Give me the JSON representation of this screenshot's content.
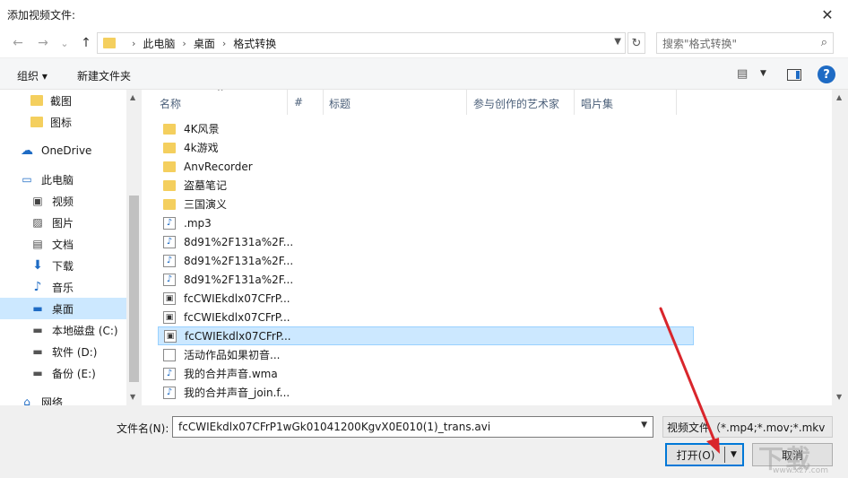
{
  "window": {
    "title": "添加视频文件:",
    "close_glyph": "✕"
  },
  "nav": {
    "back": "←",
    "forward": "→",
    "recent": "⌄",
    "up": "↑",
    "breadcrumbs": [
      "此电脑",
      "桌面",
      "格式转换"
    ],
    "refresh": "↻",
    "search_placeholder": "搜索\"格式转换\""
  },
  "toolbar": {
    "organize": "组织 ▾",
    "new_folder": "新建文件夹",
    "help": "?"
  },
  "sidebar": {
    "items": [
      {
        "label": "截图",
        "icon": "folder-icon"
      },
      {
        "label": "图标",
        "icon": "folder-icon"
      },
      {
        "label": "OneDrive",
        "icon": "cloud-icon"
      },
      {
        "label": "此电脑",
        "icon": "computer-icon"
      },
      {
        "label": "视频",
        "icon": "video-library-icon"
      },
      {
        "label": "图片",
        "icon": "pictures-icon"
      },
      {
        "label": "文档",
        "icon": "documents-icon"
      },
      {
        "label": "下载",
        "icon": "download-icon"
      },
      {
        "label": "音乐",
        "icon": "music-icon"
      },
      {
        "label": "桌面",
        "icon": "desktop-icon",
        "selected": true
      },
      {
        "label": "本地磁盘 (C:)",
        "icon": "disk-icon"
      },
      {
        "label": "软件 (D:)",
        "icon": "disk-icon"
      },
      {
        "label": "备份 (E:)",
        "icon": "disk-icon"
      },
      {
        "label": "网络",
        "icon": "network-icon"
      }
    ]
  },
  "columns": [
    "名称",
    "#",
    "标题",
    "参与创作的艺术家",
    "唱片集"
  ],
  "files": [
    {
      "name": "4K风景",
      "type": "folder"
    },
    {
      "name": "4k游戏",
      "type": "folder"
    },
    {
      "name": "AnvRecorder",
      "type": "folder"
    },
    {
      "name": "盗墓笔记",
      "type": "folder"
    },
    {
      "name": "三国演义",
      "type": "folder"
    },
    {
      "name": ".mp3",
      "type": "audio"
    },
    {
      "name": "8d91%2F131a%2F...",
      "type": "audio"
    },
    {
      "name": "8d91%2F131a%2F...",
      "type": "audio"
    },
    {
      "name": "8d91%2F131a%2F...",
      "type": "audio"
    },
    {
      "name": "fcCWIEkdlx07CFrP...",
      "type": "video"
    },
    {
      "name": "fcCWIEkdlx07CFrP...",
      "type": "video"
    },
    {
      "name": "fcCWIEkdlx07CFrP...",
      "type": "video",
      "selected": true
    },
    {
      "name": "活动作品如果初音...",
      "type": "doc"
    },
    {
      "name": "我的合并声音.wma",
      "type": "audio"
    },
    {
      "name": "我的合并声音_join.f...",
      "type": "audio"
    }
  ],
  "footer": {
    "filename_label": "文件名(N):",
    "filename_value": "fcCWIEkdlx07CFrP1wGk01041200KgvX0E010(1)_trans.avi",
    "filetype_value": "视频文件（*.mp4;*.mov;*.mkv",
    "open_label": "打开(O)",
    "cancel_label": "取消"
  },
  "watermark": {
    "main": "下载",
    "sub": "www.xz7.com"
  },
  "colors": {
    "selection": "#cce8ff",
    "accent": "#0078d7",
    "folder": "#f4cf5e",
    "arrow": "#d9262c"
  }
}
